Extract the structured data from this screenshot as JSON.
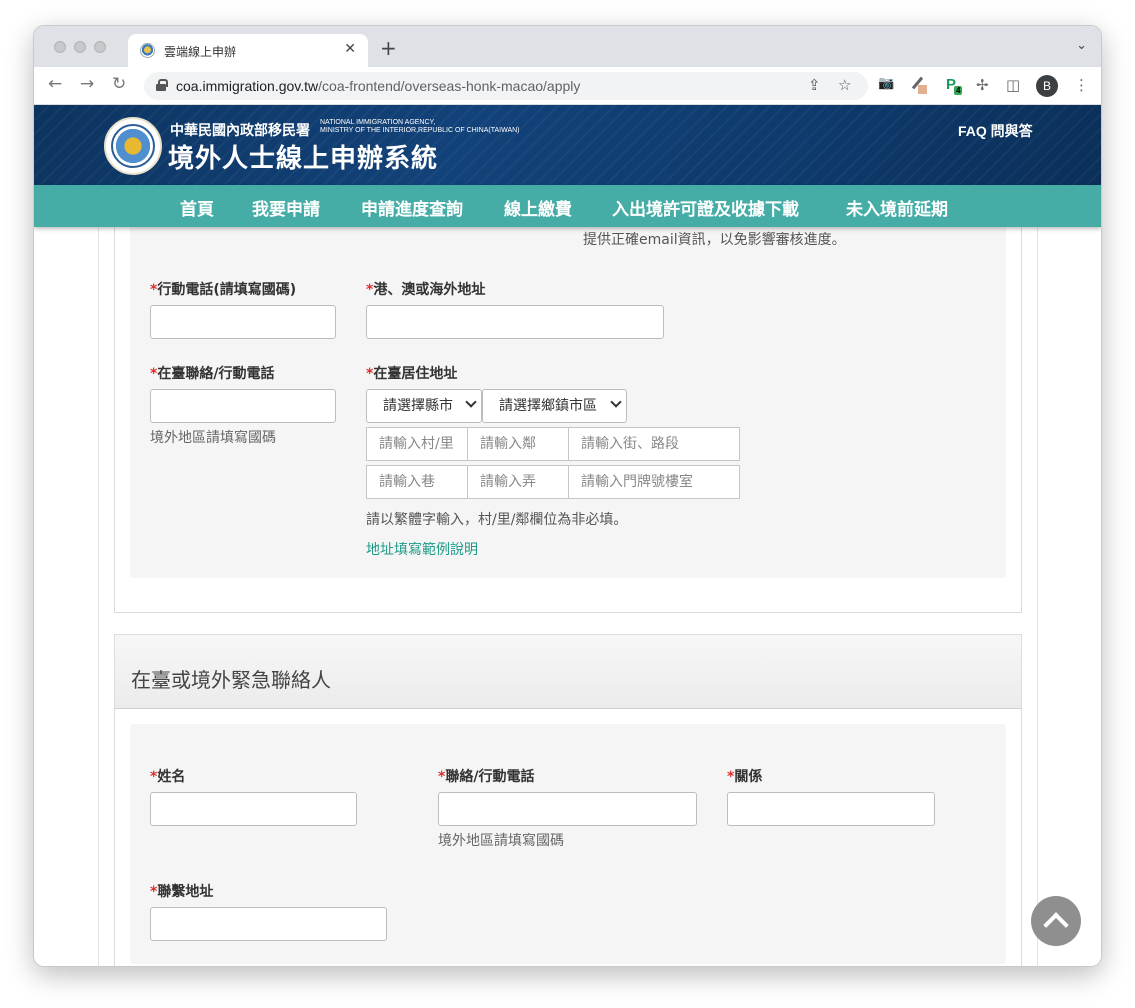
{
  "browser": {
    "tab_title": "雲端線上申辦",
    "tab_close": "✕",
    "new_tab": "+",
    "tab_menu": "⌄",
    "back": "←",
    "forward": "→",
    "reload": "↻",
    "url_host": "coa.immigration.gov.tw",
    "url_path": "/coa-frontend/overseas-honk-macao/apply",
    "share_icon": "⇪",
    "star_icon": "☆",
    "camera_icon": "📷",
    "ext_badge": "4",
    "puzzle_icon": "✢",
    "sidebar_icon": "◫",
    "avatar_letter": "B",
    "menu_icon": "⋮"
  },
  "header": {
    "agency_zh": "中華民國內政部移民署",
    "agency_en_1": "NATIONAL IMMIGRATION AGENCY,",
    "agency_en_2": "MINISTRY OF THE INTERIOR,REPUBLIC OF CHINA(TAIWAN)",
    "system_title": "境外人士線上申辦系統",
    "faq": "FAQ 問與答"
  },
  "nav": {
    "items": [
      "首頁",
      "我要申請",
      "申請進度查詢",
      "線上繳費",
      "入出境許可證及收據下載",
      "未入境前延期"
    ]
  },
  "form": {
    "email_note": "提供正確email資訊，以免影響審核進度。",
    "required_mark": "*",
    "mobile_label": "行動電話(請填寫國碼)",
    "overseas_address_label": "港、澳或海外地址",
    "tw_phone_label": "在臺聯絡/行動電話",
    "tw_phone_hint": "境外地區請填寫國碼",
    "tw_address_label": "在臺居住地址",
    "county_select": "請選擇縣市",
    "district_select": "請選擇鄉鎮市區",
    "village_placeholder": "請輸入村/里",
    "neighborhood_placeholder": "請輸入鄰",
    "street_placeholder": "請輸入街、路段",
    "lane_placeholder": "請輸入巷",
    "alley_placeholder": "請輸入弄",
    "number_placeholder": "請輸入門牌號樓室",
    "address_note": "請以繁體字輸入，村/里/鄰欄位為非必填。",
    "address_example_link": "地址填寫範例說明"
  },
  "emergency": {
    "section_title": "在臺或境外緊急聯絡人",
    "name_label": "姓名",
    "phone_label": "聯絡/行動電話",
    "phone_hint": "境外地區請填寫國碼",
    "relation_label": "關係",
    "address_label": "聯繫地址"
  }
}
